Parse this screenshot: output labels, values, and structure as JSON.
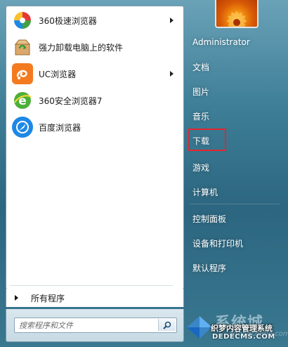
{
  "programs": [
    {
      "label": "360极速浏览器",
      "icon": "360-extreme-browser-icon",
      "has_submenu": true
    },
    {
      "label": "强力卸载电脑上的软件",
      "icon": "uninstaller-box-icon",
      "has_submenu": false
    },
    {
      "label": "UC浏览器",
      "icon": "uc-browser-icon",
      "has_submenu": true
    },
    {
      "label": "360安全浏览器7",
      "icon": "360-safe-browser-icon",
      "has_submenu": false
    },
    {
      "label": "百度浏览器",
      "icon": "baidu-browser-icon",
      "has_submenu": false
    }
  ],
  "all_programs_label": "所有程序",
  "search": {
    "placeholder": "搜索程序和文件"
  },
  "right_menu": {
    "user": "Administrator",
    "items": [
      "文档",
      "图片",
      "音乐",
      "下载",
      "游戏",
      "计算机",
      "控制面板",
      "设备和打印机",
      "默认程序"
    ],
    "highlighted": "下载"
  },
  "watermark": {
    "brand": "系统城",
    "site_cn": "织梦内容管理系统",
    "site_url": "DEDECMS.COM",
    "faint_url": "xitongcheng.com"
  },
  "colors": {
    "highlight_border": "#e3262b",
    "start_menu_bg": "#2c6680"
  }
}
